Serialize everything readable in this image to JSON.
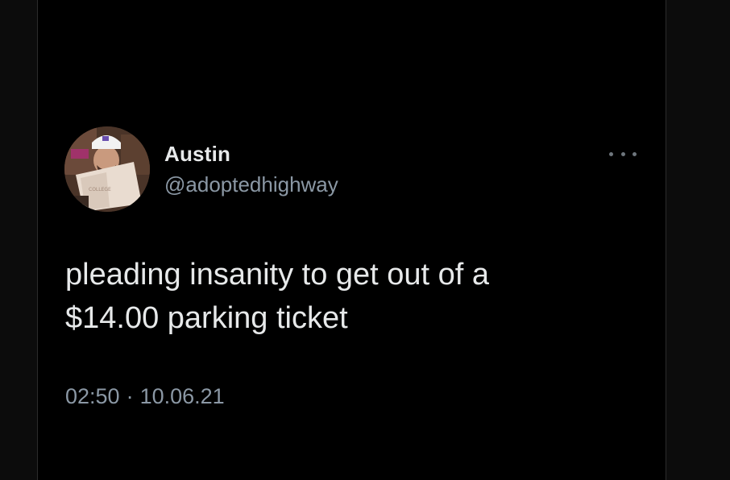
{
  "tweet": {
    "author": {
      "display_name": "Austin",
      "handle": "@adoptedhighway",
      "avatar": "profile-photo"
    },
    "text_lines": [
      "pleading insanity to get out of a",
      "$14.00 parking ticket"
    ],
    "time": "02:50",
    "separator": "·",
    "date": "10.06.21",
    "more_icon": "more-dots-icon"
  },
  "colors": {
    "background": "#000000",
    "primary_text": "#e7e9ea",
    "secondary_text": "#8b98a5",
    "side_panel": "#0c0c0c"
  }
}
